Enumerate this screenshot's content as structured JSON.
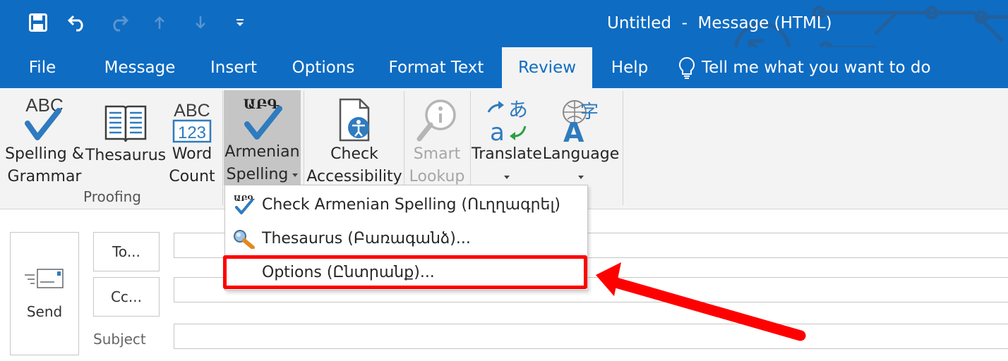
{
  "window": {
    "title": "Untitled  -  Message (HTML)",
    "qat": [
      "save-icon",
      "undo-icon",
      "redo-icon",
      "up-arrow-icon",
      "down-arrow-icon",
      "customize-qat-icon"
    ]
  },
  "tabs": [
    {
      "label": "File"
    },
    {
      "label": "Message"
    },
    {
      "label": "Insert"
    },
    {
      "label": "Options"
    },
    {
      "label": "Format Text"
    },
    {
      "label": "Review",
      "active": true
    },
    {
      "label": "Help"
    }
  ],
  "tell_me": "Tell me what you want to do",
  "ribbon": {
    "proofing": {
      "label": "Proofing",
      "spelling": {
        "line1": "Spelling &",
        "line2": "Grammar",
        "icon_text": "ABC"
      },
      "thesaurus": {
        "line1": "Thesaurus"
      },
      "word_count": {
        "line1": "Word",
        "line2": "Count",
        "icon_top": "ABC",
        "icon_bottom": "123"
      }
    },
    "armenian": {
      "line1": "Armenian",
      "line2": "Spelling",
      "icon_text": "ԱԲԳ"
    },
    "accessibility": {
      "line1": "Check",
      "line2": "Accessibility"
    },
    "smart_lookup": {
      "line1": "Smart",
      "line2": "Lookup"
    },
    "translate": {
      "line1": "Translate"
    },
    "language": {
      "line1": "Language",
      "icon_glyph": "字"
    }
  },
  "menu": {
    "items": [
      {
        "label": "Check Armenian Spelling (Ուղղագրել)",
        "icon_text": "ԱԲԳ"
      },
      {
        "label": "Thesaurus (Բառագանձ)..."
      },
      {
        "label": "Options (Ընտրանք)..."
      }
    ],
    "highlight_color": "#ff0000"
  },
  "compose": {
    "send": "Send",
    "to": "To...",
    "cc": "Cc...",
    "subject": "Subject"
  },
  "colors": {
    "brand_blue": "#0e6cc3",
    "ribbon_bg": "#f3f3f3",
    "annotation_red": "#ff0000"
  }
}
